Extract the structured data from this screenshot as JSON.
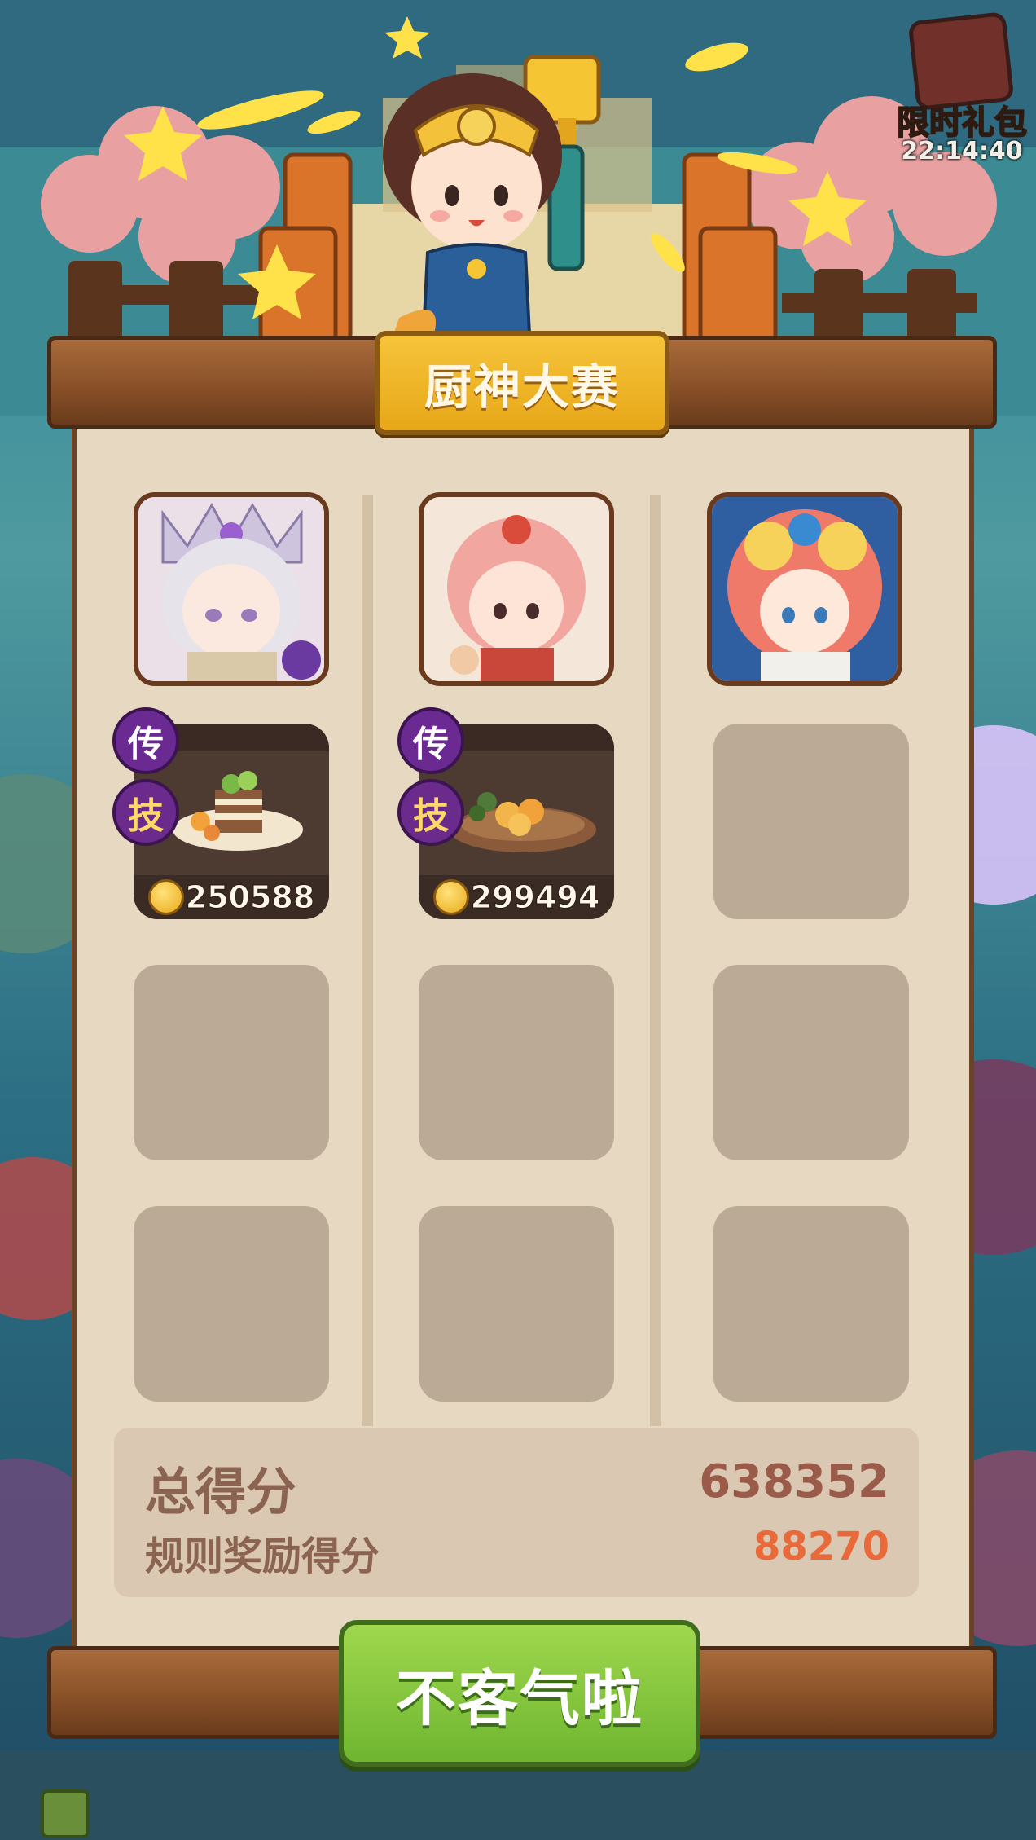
{
  "gift": {
    "label": "限时礼包",
    "timer": "22:14:40"
  },
  "title": "厨神大赛",
  "columns": [
    {
      "dish": {
        "badges": [
          "传",
          "技"
        ],
        "price": "250588"
      }
    },
    {
      "dish": {
        "badges": [
          "传",
          "技"
        ],
        "price": "299494"
      }
    },
    {
      "dish": null
    }
  ],
  "score": {
    "total_label": "总得分",
    "total_value": "638352",
    "rule_label": "规则奖励得分",
    "rule_value": "88270"
  },
  "button_label": "不客气啦",
  "colors": {
    "panel": "#e6d8c1",
    "slot": "#bbab96",
    "title_plaque": "#f6c43a",
    "button_green": "#8cc83f",
    "rule_value": "#e86a3a",
    "total_value": "#9a5b4a"
  },
  "icons": [
    "coin-icon",
    "gift-box-icon",
    "star-icon",
    "golden-spatula-icon"
  ]
}
